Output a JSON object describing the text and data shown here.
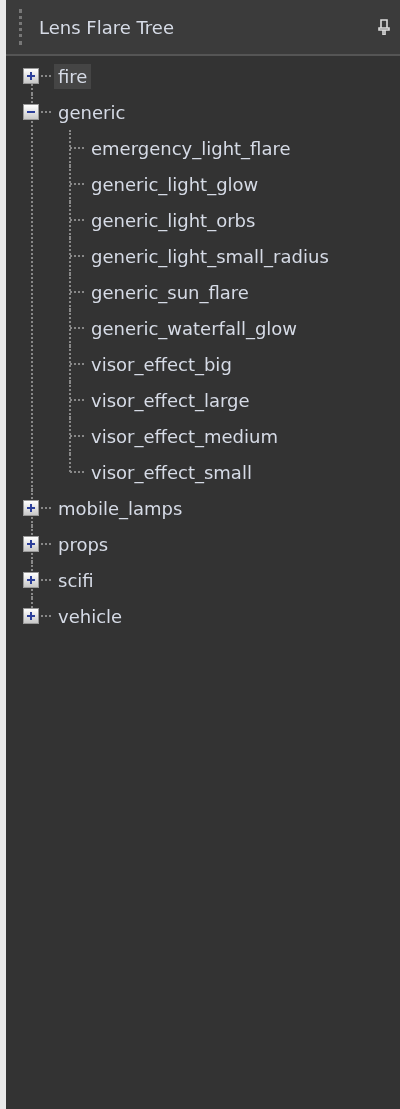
{
  "panel": {
    "title": "Lens Flare Tree"
  },
  "tree": [
    {
      "label": "fire",
      "expanded": false,
      "selected": true
    },
    {
      "label": "generic",
      "expanded": true,
      "selected": false,
      "children": [
        {
          "label": "emergency_light_flare",
          "selected": false
        },
        {
          "label": "generic_light_glow",
          "selected": false
        },
        {
          "label": "generic_light_orbs",
          "selected": false
        },
        {
          "label": "generic_light_small_radius",
          "selected": false
        },
        {
          "label": "generic_sun_flare",
          "selected": false
        },
        {
          "label": "generic_waterfall_glow",
          "selected": false
        },
        {
          "label": "visor_effect_big",
          "selected": false
        },
        {
          "label": "visor_effect_large",
          "selected": false
        },
        {
          "label": "visor_effect_medium",
          "selected": false
        },
        {
          "label": "visor_effect_small",
          "selected": false
        }
      ]
    },
    {
      "label": "mobile_lamps",
      "expanded": false,
      "selected": false
    },
    {
      "label": "props",
      "expanded": false,
      "selected": false
    },
    {
      "label": "scifi",
      "expanded": false,
      "selected": false
    },
    {
      "label": "vehicle",
      "expanded": false,
      "selected": false
    }
  ]
}
